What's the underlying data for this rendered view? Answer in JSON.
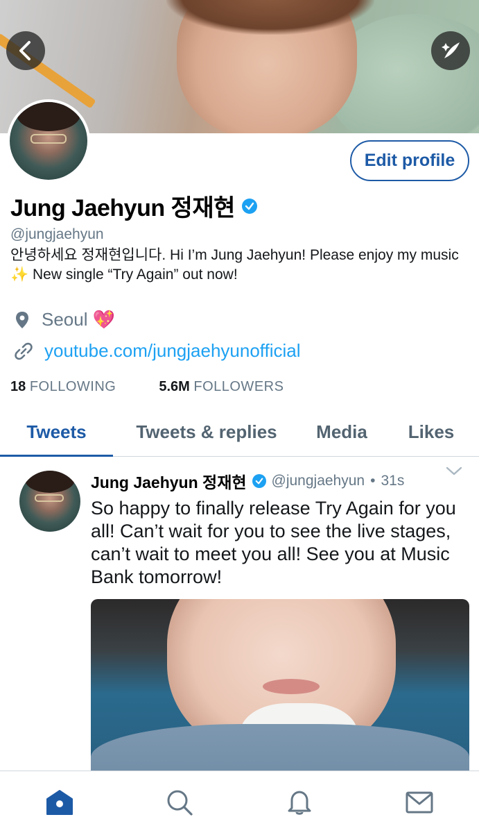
{
  "header": {
    "back_icon": "chevron-left-icon",
    "compose_icon": "compose-tweet-icon"
  },
  "profile": {
    "name": "Jung Jaehyun 정재현",
    "handle": "@jungjaehyun",
    "bio": "안녕하세요 정재현입니다. Hi I’m Jung Jaehyun! Please enjoy my music ✨ New single “Try Again” out now!",
    "location": "Seoul 💖",
    "website": "youtube.com/jungjaehyunofficial",
    "edit_profile_label": "Edit profile",
    "following_count": "18",
    "following_label": "FOLLOWING",
    "followers_count": "5.6M",
    "followers_label": "FOLLOWERS"
  },
  "tabs": [
    {
      "label": "Tweets",
      "active": true
    },
    {
      "label": "Tweets & replies",
      "active": false
    },
    {
      "label": "Media",
      "active": false
    },
    {
      "label": "Likes",
      "active": false
    }
  ],
  "tweet": {
    "author_name": "Jung Jaehyun 정재현",
    "author_handle": "@jungjaehyun",
    "separator": "•",
    "time": "31s",
    "text": "So happy to finally release Try Again for you all! Can’t wait for you to see the live stages, can’t wait to meet you all! See you at Music Bank tomorrow!"
  },
  "bottom_nav": [
    {
      "icon": "home-icon",
      "active": true
    },
    {
      "icon": "search-icon",
      "active": false
    },
    {
      "icon": "notifications-bell-icon",
      "active": false
    },
    {
      "icon": "messages-envelope-icon",
      "active": false
    }
  ],
  "colors": {
    "accent": "#1d5aa6",
    "link": "#1da1f2",
    "verified": "#1da1f2",
    "muted": "#657786"
  }
}
